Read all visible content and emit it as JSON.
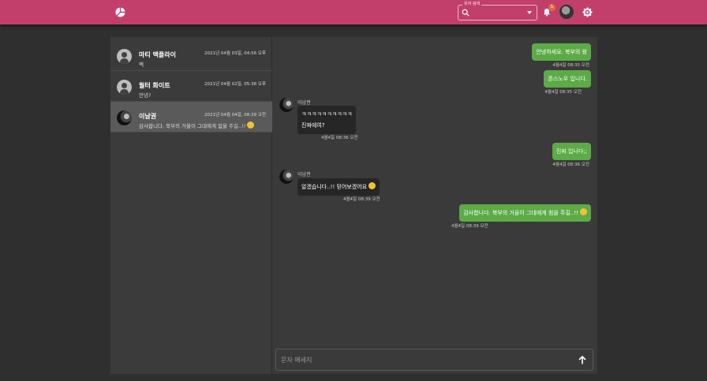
{
  "header": {
    "search_label": "유저 검색",
    "notification_count": "5",
    "icons": [
      "logo-icon",
      "search-icon",
      "dropdown-icon",
      "bell-icon",
      "avatar",
      "gear-icon"
    ],
    "accent": "#c13f6a"
  },
  "conversations": [
    {
      "name": "마티 맥플라이",
      "time": "2021년 04월 03일, 04:56 오후",
      "preview": "멕",
      "avatar": "default"
    },
    {
      "name": "월터 화이트",
      "time": "2021년 04월 02일, 05:38 오후",
      "preview": "안녕?",
      "avatar": "default"
    },
    {
      "name": "이남권",
      "time": "2021년 04월 04일, 08:39 오전",
      "preview": "감사합니다. 북부의 거울이 그대에게 힘을 주길..!!",
      "avatar": "photo",
      "active": true
    }
  ],
  "messages": [
    {
      "dir": "out",
      "text": "안녕하세요. 북부의 왕",
      "time": "4월4일 08:35 오전"
    },
    {
      "dir": "out",
      "text": "존스노우 입니다.",
      "time": "4월4일 08:35 오전"
    },
    {
      "dir": "in",
      "sender": "이남권",
      "lines": [
        "ㅋㅋㅋㅋㅋㅋㅋㅋㅋㅋ",
        "진짜에여?"
      ],
      "time": "4월4일 08:36 오전"
    },
    {
      "dir": "out",
      "text": "진짜 입니다;;",
      "time": "4월4일 08:36 오전"
    },
    {
      "dir": "in",
      "sender": "이남권",
      "lines": [
        "알겠습니다..!! 믿어보겠어요"
      ],
      "time": "4월4일 08:39 오전"
    },
    {
      "dir": "out",
      "text": "감사합니다. 북부의 거울이 그대에게 힘을 주길..!!",
      "time": "4월4일 08:39 오전"
    }
  ],
  "composer": {
    "placeholder": "문자 메세지",
    "value": ""
  },
  "colors": {
    "bubble_out": "#5cab47",
    "bubble_in": "#262626",
    "background": "#2f2f2f"
  }
}
